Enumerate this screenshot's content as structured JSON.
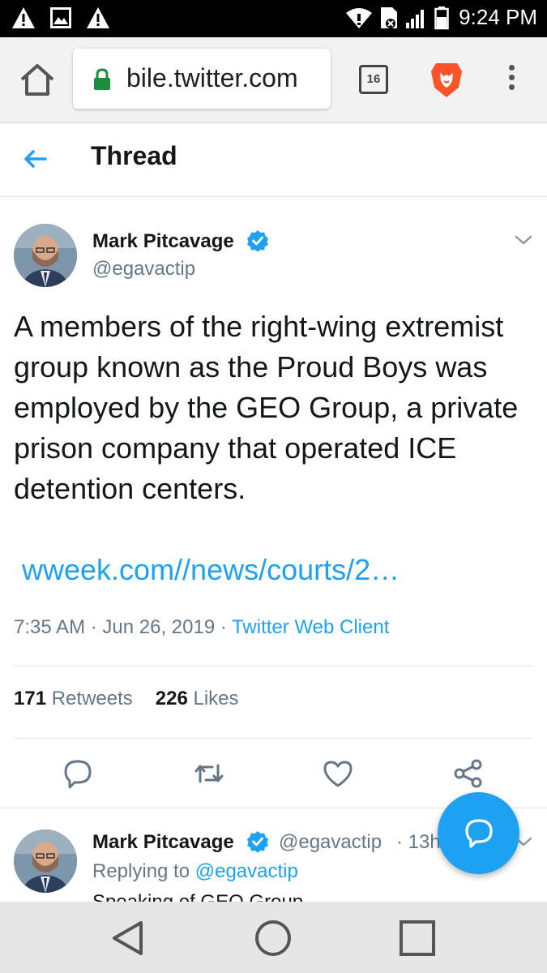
{
  "status_bar": {
    "time": "9:24 PM",
    "left_icons": [
      "warning-icon",
      "image-icon",
      "warning-icon"
    ],
    "right_icons": [
      "wifi-icon",
      "no-sim-icon",
      "signal-icon",
      "battery-icon"
    ]
  },
  "browser": {
    "url": "bile.twitter.com",
    "tab_count": "16",
    "icons": [
      "home-icon",
      "lock-icon",
      "brave-lion-icon",
      "more-vert-icon"
    ]
  },
  "header": {
    "title": "Thread"
  },
  "tweet": {
    "author_name": "Mark Pitcavage",
    "author_handle": "@egavactip",
    "text": "A members of the right-wing extremist group known as the Proud Boys was employed by the GEO Group, a private prison company that operated ICE detention centers.",
    "link": "wweek.com//news/courts/2…",
    "time": "7:35 AM",
    "date": "Jun 26, 2019",
    "client": "Twitter Web Client",
    "separator": " · ",
    "retweet_count": "171",
    "retweet_label": "Retweets",
    "like_count": "226",
    "like_label": "Likes"
  },
  "reply_tweet": {
    "author_name": "Mark Pitcavage",
    "author_handle": "@egavactip",
    "age": "· 13h",
    "replying_label": "Replying to",
    "replying_handle": "@egavactip",
    "snippet": "Speaking of GEO Group"
  },
  "colors": {
    "accent": "#1da1f2",
    "secondary_text": "#657786",
    "primary_text": "#14171a"
  }
}
